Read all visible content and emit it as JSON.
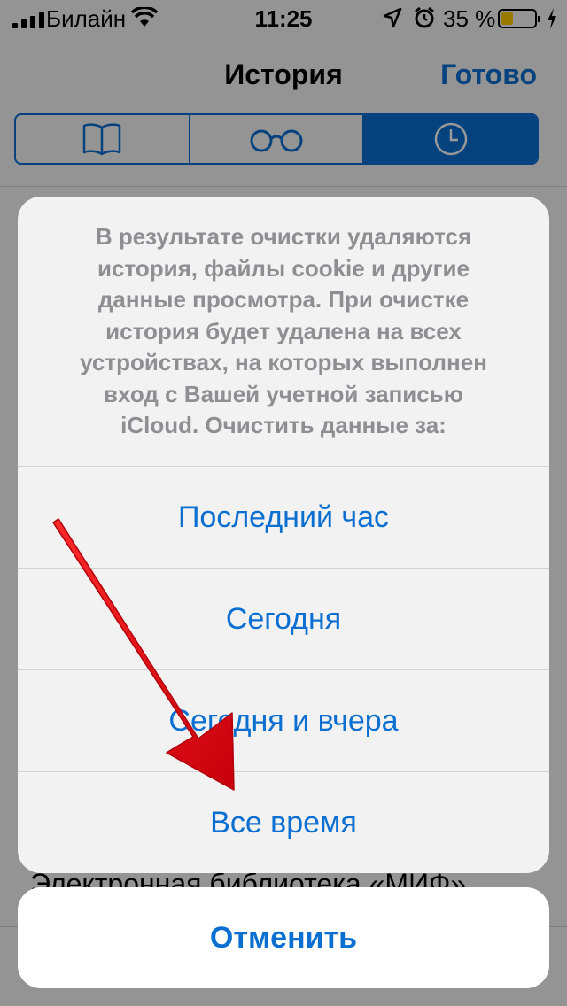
{
  "status_bar": {
    "carrier": "Билайн",
    "time": "11:25",
    "battery_percent": "35 %",
    "battery_level": 0.35,
    "battery_color": "#ffcc00"
  },
  "nav": {
    "title": "История",
    "done_label": "Готово"
  },
  "segments": [
    {
      "icon": "book-icon",
      "selected": false
    },
    {
      "icon": "glasses-icon",
      "selected": false
    },
    {
      "icon": "clock-icon",
      "selected": true
    }
  ],
  "background": {
    "visible_item": "Электронная библиотека «МИФ»"
  },
  "sheet": {
    "message": "В результате очистки удаляются история, файлы cookie и другие данные просмотра. При очистке история будет удалена на всех устройствах, на которых выполнен вход с Вашей учетной записью iCloud. Очистить данные за:",
    "options": [
      {
        "label": "Последний час"
      },
      {
        "label": "Сегодня"
      },
      {
        "label": "Сегодня и вчера"
      },
      {
        "label": "Все время"
      }
    ],
    "cancel_label": "Отменить"
  },
  "colors": {
    "accent": "#0a6fd1",
    "annotation_arrow": "#e0101a"
  }
}
